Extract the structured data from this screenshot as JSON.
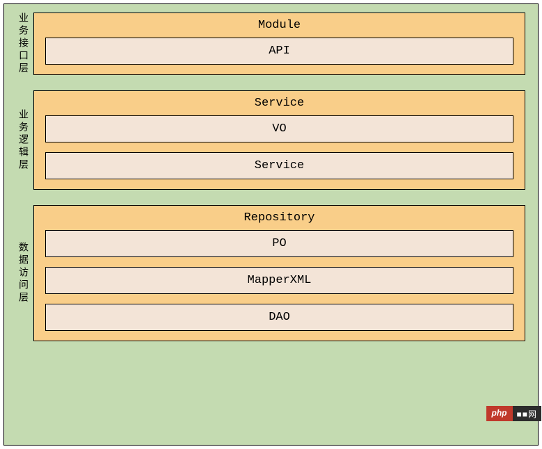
{
  "layers": [
    {
      "vlabel": "业务接口层",
      "title": "Module",
      "boxes": [
        "API"
      ]
    },
    {
      "vlabel": "业务逻辑层",
      "title": "Service",
      "boxes": [
        "VO",
        "Service"
      ]
    },
    {
      "vlabel": "数据访问层",
      "title": "Repository",
      "boxes": [
        "PO",
        "MapperXML",
        "DAO"
      ]
    }
  ],
  "watermark": {
    "left": "php",
    "right": "■■网"
  }
}
